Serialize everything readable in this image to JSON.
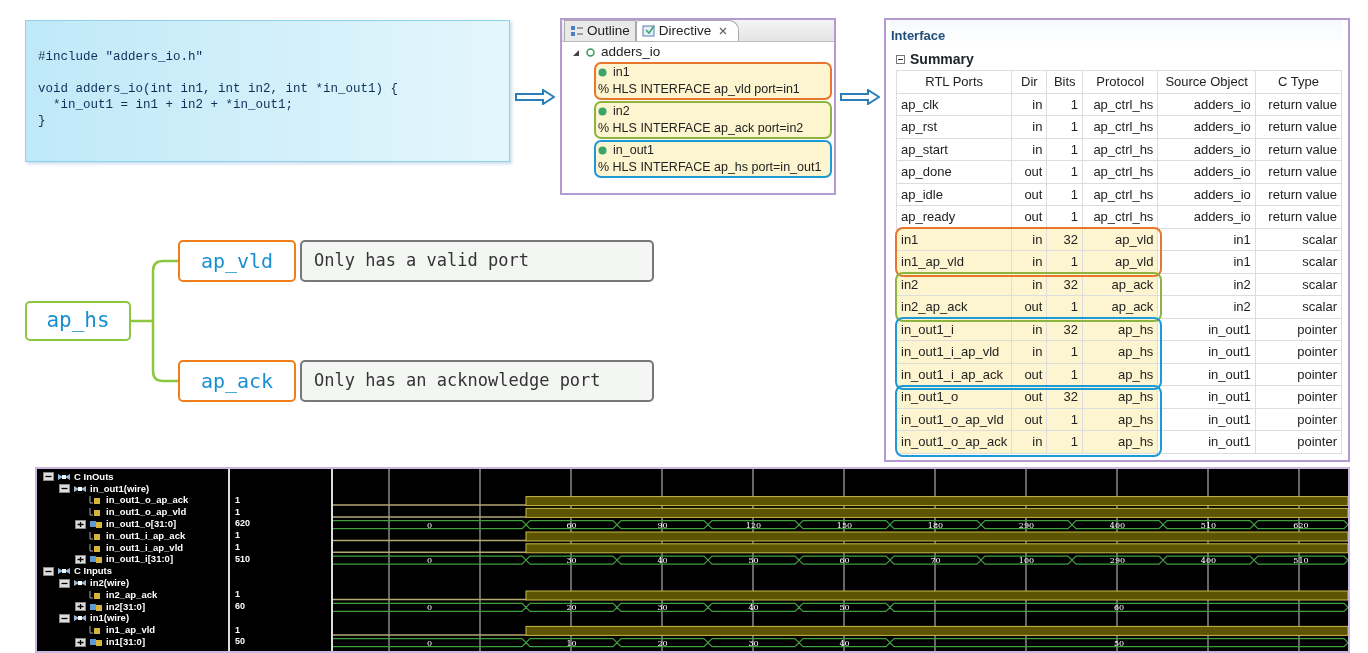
{
  "code_box": {
    "code": "#include \"adders_io.h\"\n\nvoid adders_io(int in1, int in2, int *in_out1) {\n  *in_out1 = in1 + in2 + *in_out1;\n}"
  },
  "directive_view": {
    "tabs": [
      {
        "label": "Outline",
        "selected": false,
        "closable": false
      },
      {
        "label": "Directive",
        "selected": true,
        "closable": true
      }
    ],
    "tree": {
      "label": "adders_io",
      "expanded": true,
      "children": [
        {
          "label": "in1",
          "directive": "% HLS INTERFACE ap_vld port=in1",
          "color": "#e8772e"
        },
        {
          "label": "in2",
          "directive": "% HLS INTERFACE ap_ack port=in2",
          "color": "#8db43f"
        },
        {
          "label": "in_out1",
          "directive": "% HLS INTERFACE ap_hs port=in_out1",
          "color": "#1b9ad6"
        }
      ]
    }
  },
  "diagram": {
    "root": {
      "label": "ap_hs",
      "color": "#8dc63f"
    },
    "branches": [
      {
        "label": "ap_vld",
        "color": "#f07f1a",
        "description": "Only has a valid port"
      },
      {
        "label": "ap_ack",
        "color": "#f07f1a",
        "description": "Only has an acknowledge port"
      }
    ]
  },
  "interface": {
    "title": "Interface",
    "section": {
      "label": "Summary",
      "expanded": true
    },
    "columns": [
      "RTL Ports",
      "Dir",
      "Bits",
      "Protocol",
      "Source Object",
      "C Type"
    ],
    "groups": [
      {
        "rows": [
          [
            "ap_clk",
            "in",
            "1",
            "ap_ctrl_hs",
            "adders_io",
            "return value"
          ],
          [
            "ap_rst",
            "in",
            "1",
            "ap_ctrl_hs",
            "adders_io",
            "return value"
          ],
          [
            "ap_start",
            "in",
            "1",
            "ap_ctrl_hs",
            "adders_io",
            "return value"
          ],
          [
            "ap_done",
            "out",
            "1",
            "ap_ctrl_hs",
            "adders_io",
            "return value"
          ],
          [
            "ap_idle",
            "out",
            "1",
            "ap_ctrl_hs",
            "adders_io",
            "return value"
          ],
          [
            "ap_ready",
            "out",
            "1",
            "ap_ctrl_hs",
            "adders_io",
            "return value"
          ]
        ]
      },
      {
        "color": "#e8772e",
        "rows": [
          [
            "in1",
            "in",
            "32",
            "ap_vld",
            "in1",
            "scalar"
          ],
          [
            "in1_ap_vld",
            "in",
            "1",
            "ap_vld",
            "in1",
            "scalar"
          ]
        ]
      },
      {
        "color": "#8db43f",
        "rows": [
          [
            "in2",
            "in",
            "32",
            "ap_ack",
            "in2",
            "scalar"
          ],
          [
            "in2_ap_ack",
            "out",
            "1",
            "ap_ack",
            "in2",
            "scalar"
          ]
        ]
      },
      {
        "color": "#1b9ad6",
        "rows": [
          [
            "in_out1_i",
            "in",
            "32",
            "ap_hs",
            "in_out1",
            "pointer"
          ],
          [
            "in_out1_i_ap_vld",
            "in",
            "1",
            "ap_hs",
            "in_out1",
            "pointer"
          ],
          [
            "in_out1_i_ap_ack",
            "out",
            "1",
            "ap_hs",
            "in_out1",
            "pointer"
          ]
        ]
      },
      {
        "color": "#1b9ad6",
        "rows": [
          [
            "in_out1_o",
            "out",
            "32",
            "ap_hs",
            "in_out1",
            "pointer"
          ],
          [
            "in_out1_o_ap_vld",
            "out",
            "1",
            "ap_hs",
            "in_out1",
            "pointer"
          ],
          [
            "in_out1_o_ap_ack",
            "in",
            "1",
            "ap_hs",
            "in_out1",
            "pointer"
          ]
        ]
      }
    ]
  },
  "waveform": {
    "signals": [
      {
        "label": "C InOuts",
        "kind": "group",
        "expanded": true,
        "children": [
          {
            "label": "in_out1(wire)",
            "kind": "group",
            "expanded": true,
            "children": [
              {
                "label": "in_out1_o_ap_ack",
                "kind": "bit",
                "value": "1"
              },
              {
                "label": "in_out1_o_ap_vld",
                "kind": "bit",
                "value": "1"
              },
              {
                "label": "in_out1_o[31:0]",
                "kind": "bus",
                "expanded": false,
                "value": "620",
                "segments": [
                  "0",
                  "60",
                  "90",
                  "120",
                  "150",
                  "180",
                  "290",
                  "400",
                  "510",
                  "620"
                ]
              },
              {
                "label": "in_out1_i_ap_ack",
                "kind": "bit",
                "value": "1"
              },
              {
                "label": "in_out1_i_ap_vld",
                "kind": "bit",
                "value": "1"
              },
              {
                "label": "in_out1_i[31:0]",
                "kind": "bus",
                "expanded": false,
                "value": "510",
                "segments": [
                  "0",
                  "30",
                  "40",
                  "50",
                  "60",
                  "70",
                  "100",
                  "290",
                  "400",
                  "510"
                ]
              }
            ]
          }
        ]
      },
      {
        "label": "C Inputs",
        "kind": "group",
        "expanded": true,
        "children": [
          {
            "label": "in2(wire)",
            "kind": "group",
            "expanded": true,
            "children": [
              {
                "label": "in2_ap_ack",
                "kind": "bit",
                "value": "1"
              },
              {
                "label": "in2[31:0]",
                "kind": "bus",
                "expanded": false,
                "value": "60",
                "segments": [
                  "0",
                  "20",
                  "30",
                  "40",
                  "50",
                  "60"
                ]
              }
            ]
          },
          {
            "label": "in1(wire)",
            "kind": "group",
            "expanded": true,
            "children": [
              {
                "label": "in1_ap_vld",
                "kind": "bit",
                "value": "1"
              },
              {
                "label": "in1[31:0]",
                "kind": "bus",
                "expanded": false,
                "value": "50",
                "segments": [
                  "0",
                  "10",
                  "20",
                  "30",
                  "40",
                  "50"
                ]
              }
            ]
          }
        ]
      }
    ]
  }
}
